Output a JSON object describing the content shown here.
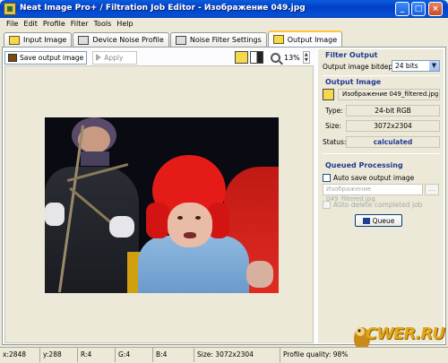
{
  "window": {
    "title": "Neat Image Pro+ / Filtration Job Editor - Изображение 049.jpg",
    "controls": [
      "_",
      "□",
      "×"
    ]
  },
  "menu": {
    "file": "File",
    "edit": "Edit",
    "profile": "Profile",
    "filter": "Filter",
    "tools": "Tools",
    "help": "Help"
  },
  "tabs": [
    {
      "label": "Input Image",
      "icon": "input-image-icon"
    },
    {
      "label": "Device Noise Profile",
      "icon": "device-profile-icon"
    },
    {
      "label": "Noise Filter Settings",
      "icon": "filter-settings-icon"
    },
    {
      "label": "Output Image",
      "icon": "output-image-icon",
      "active": true
    }
  ],
  "toolbar": {
    "save_output_image": "Save output image",
    "apply": "Apply",
    "zoom": "13%"
  },
  "filter_output": {
    "title": "Filter Output",
    "bitdepth_label": "Output image bitdepth:",
    "bitdepth_value": "24 bits"
  },
  "output_image": {
    "title": "Output Image",
    "filename": "Изображение 049_filtered.jpg *",
    "type_label": "Type:",
    "type_value": "24-bit RGB",
    "size_label": "Size:",
    "size_value": "3072x2304",
    "status_label": "Status:",
    "status_value": "calculated"
  },
  "queued_processing": {
    "title": "Queued Processing",
    "auto_save_label": "Auto save output image",
    "filename_placeholder": "Изображение 049_filtered.jpg",
    "browse_label": "...",
    "auto_delete_label": "Auto delete completed job",
    "queue_button": "Queue"
  },
  "statusbar": {
    "x": "x:2848",
    "y": "y:288",
    "r": "R:4",
    "g": "G:4",
    "b": "B:4",
    "size": "Size: 3072x2304",
    "quality": "Profile quality: 98%"
  },
  "watermark": "CWER.RU",
  "colors": {
    "title_blue": "#0451d6",
    "section_blue": "#1f3a93",
    "tab_highlight": "#ffc83c"
  }
}
